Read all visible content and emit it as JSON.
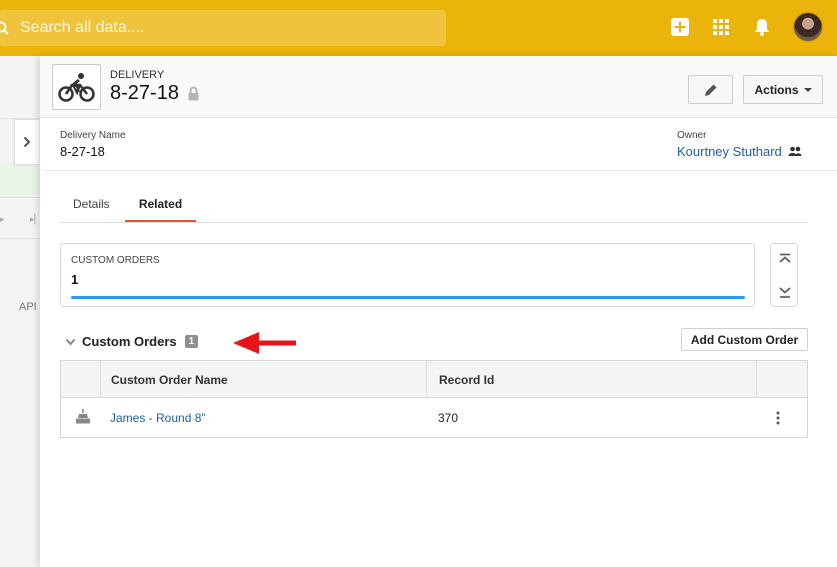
{
  "search": {
    "placeholder": "Search all data...."
  },
  "topbar": {
    "icons": [
      "search-icon",
      "add-icon",
      "app-launcher-icon",
      "notifications-icon",
      "avatar"
    ]
  },
  "left": {
    "partial_text": "API"
  },
  "record": {
    "object_type": "DELIVERY",
    "title": "8-27-18",
    "icon": "bicycle-icon",
    "actions_label": "Actions"
  },
  "fields": {
    "delivery_name_label": "Delivery Name",
    "delivery_name_value": "8-27-18",
    "owner_label": "Owner",
    "owner_value": "Kourtney Stuthard"
  },
  "tabs": [
    {
      "label": "Details",
      "active": false
    },
    {
      "label": "Related",
      "active": true
    }
  ],
  "summary": {
    "label": "CUSTOM ORDERS",
    "count": "1"
  },
  "related_list": {
    "title": "Custom Orders",
    "count": "1",
    "add_label": "Add Custom Order",
    "columns": [
      "Custom Order Name",
      "Record Id"
    ],
    "rows": [
      {
        "name": "James - Round 8\"",
        "record_id": "370"
      }
    ]
  },
  "colors": {
    "topbar": "#ebb40a",
    "link": "#1f5fa8",
    "active_tab": "#e0572b",
    "progress": "#2b9bea",
    "annotation_arrow": "#e8141b"
  }
}
